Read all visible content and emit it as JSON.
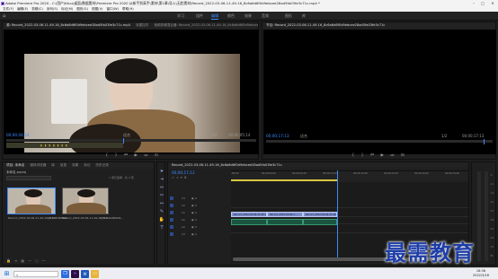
{
  "window": {
    "title": "Adobe Premiere Pro 2020 - C:\\用户\\Ktuu\\桌面\\数据素材\\Premiere Pro 2020 从新手到高手\\素材\\第1章\\导入\\无脸素材\\Record_2022-03-06-11-49-16_8c6a6d6f0d9ebcee28ad5fa03fe3c71c.mp4 *"
  },
  "menu": [
    "文件(F)",
    "编辑(E)",
    "剪辑(C)",
    "序列(S)",
    "标记(M)",
    "图形(G)",
    "视图(V)",
    "窗口(W)",
    "帮助(H)"
  ],
  "workspace": {
    "tabs": [
      "学习",
      "组件",
      "编辑",
      "颜色",
      "效果",
      "音频",
      "图形",
      "库"
    ],
    "active": "编辑"
  },
  "source": {
    "tabs": [
      "源: Record_2022-03-06-11-49-16_8c6a6d6f0d9ebcee28ad5fa03fe3c71c.mp4",
      "效果控件",
      "音频剪辑混合器: Record_2022-03-06-11-49-16_8c6a6d6f0d9ebcee28ad5fa03fe3c71c",
      "元数据"
    ],
    "tc_left": "00;00;04;14",
    "fit": "适合",
    "res": "1/2",
    "tc_right": "00;00;05;14"
  },
  "program": {
    "tab": "节目: Record_2022-03-06-11-49-16_8c6a6d6f0d9ebcee28ad5fa03fe3c71c",
    "tc_left": "00;00;17;13",
    "fit": "适合",
    "res": "1/2",
    "tc_right": "00;00;17;13"
  },
  "project": {
    "tabs": [
      "项目: 未命名",
      "媒体浏览器",
      "库",
      "信息",
      "效果",
      "标记",
      "历史记录"
    ],
    "name": "未命名.prproj",
    "count": "1 项已选择，共 2 项",
    "items": [
      {
        "name": "Record_2022-03-06-11-49-16_8c6a6d6f0d9...",
        "dur": "17;13"
      },
      {
        "name": "Record_2022-03-06-11-49-16_8c6a6d6f0d9...",
        "dur": "17;13"
      }
    ]
  },
  "timeline": {
    "tab": "Record_2022-03-06-11-49-16_8c6a6d6f0d9ebcee28ad5fa03fe3c71c",
    "tc": "00;00;17;13",
    "ticks": [
      ":00;00",
      "00;00;04;29",
      "00;00;09;29",
      "00;00;14;29",
      "00;00;19;29",
      "00;00;24;29",
      "00;00;29;29",
      "00;00;34;28"
    ],
    "video_tracks": [
      "V3",
      "V2",
      "V1"
    ],
    "audio_tracks": [
      "A1",
      "A2",
      "A3"
    ],
    "clips": [
      "Record_2022-03-06-11-49-16_8c6a6d6f0d9ebcee28ad5fa03fe3c71c.mp4 [V]",
      "Record_2022-03-06-1...",
      "Record_2022-03-06-11-49-16_8c6a6d"
    ]
  },
  "watermark": "最需教育",
  "taskbar": {
    "time": "16:38",
    "date": "2022/3/16"
  }
}
